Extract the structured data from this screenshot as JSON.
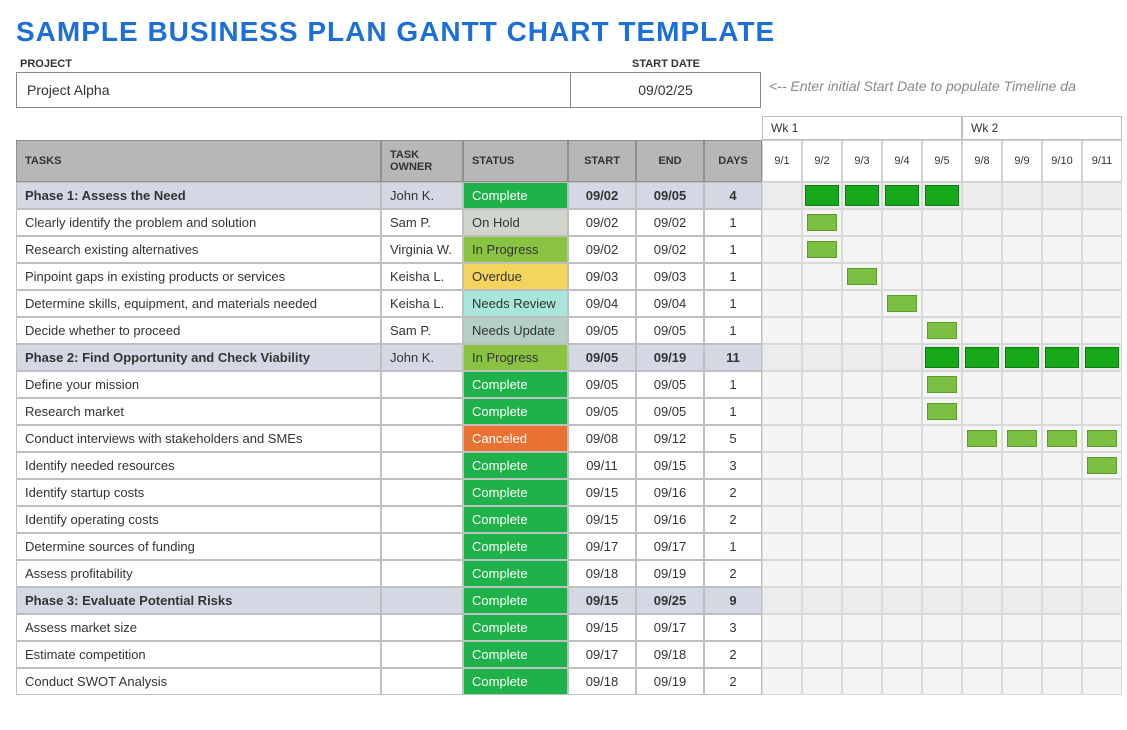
{
  "title": "SAMPLE BUSINESS PLAN GANTT CHART TEMPLATE",
  "labels": {
    "project": "PROJECT",
    "start_date": "START DATE",
    "hint": "<--  Enter initial Start Date to populate Timeline da",
    "tasks": "TASKS",
    "owner": "TASK OWNER",
    "status": "STATUS",
    "start": "START",
    "end": "END",
    "days": "DAYS"
  },
  "project_name": "Project Alpha",
  "project_start": "09/02/25",
  "weeks": [
    "Wk 1",
    "Wk 2"
  ],
  "timeline_days": [
    "9/1",
    "9/2",
    "9/3",
    "9/4",
    "9/5",
    "9/8",
    "9/9",
    "9/10",
    "9/11"
  ],
  "chart_data": {
    "type": "gantt",
    "x_categories": [
      "9/1",
      "9/2",
      "9/3",
      "9/4",
      "9/5",
      "9/8",
      "9/9",
      "9/10",
      "9/11"
    ],
    "rows": [
      {
        "type": "phase",
        "name": "Phase 1: Assess the Need",
        "owner": "John K.",
        "status": "Complete",
        "start": "09/02",
        "end": "09/05",
        "days": 4,
        "bar": [
          1,
          4
        ]
      },
      {
        "type": "task",
        "name": "Clearly identify the problem and solution",
        "owner": "Sam P.",
        "status": "On Hold",
        "start": "09/02",
        "end": "09/02",
        "days": 1,
        "bar": [
          1,
          1
        ]
      },
      {
        "type": "task",
        "name": "Research existing alternatives",
        "owner": "Virginia W.",
        "status": "In Progress",
        "start": "09/02",
        "end": "09/02",
        "days": 1,
        "bar": [
          1,
          1
        ]
      },
      {
        "type": "task",
        "name": "Pinpoint gaps in existing products or services",
        "owner": "Keisha L.",
        "status": "Overdue",
        "start": "09/03",
        "end": "09/03",
        "days": 1,
        "bar": [
          2,
          2
        ]
      },
      {
        "type": "task",
        "name": "Determine skills, equipment, and materials needed",
        "owner": "Keisha L.",
        "status": "Needs Review",
        "start": "09/04",
        "end": "09/04",
        "days": 1,
        "bar": [
          3,
          3
        ]
      },
      {
        "type": "task",
        "name": "Decide whether to proceed",
        "owner": "Sam P.",
        "status": "Needs Update",
        "start": "09/05",
        "end": "09/05",
        "days": 1,
        "bar": [
          4,
          4
        ]
      },
      {
        "type": "phase",
        "name": "Phase 2: Find Opportunity and Check Viability",
        "owner": "John K.",
        "status": "In Progress",
        "start": "09/05",
        "end": "09/19",
        "days": 11,
        "bar": [
          4,
          8
        ]
      },
      {
        "type": "task",
        "name": "Define your mission",
        "owner": "",
        "status": "Complete",
        "start": "09/05",
        "end": "09/05",
        "days": 1,
        "bar": [
          4,
          4
        ]
      },
      {
        "type": "task",
        "name": "Research market",
        "owner": "",
        "status": "Complete",
        "start": "09/05",
        "end": "09/05",
        "days": 1,
        "bar": [
          4,
          4
        ]
      },
      {
        "type": "task",
        "name": "Conduct interviews with stakeholders and SMEs",
        "owner": "",
        "status": "Canceled",
        "start": "09/08",
        "end": "09/12",
        "days": 5,
        "bar": [
          5,
          8
        ]
      },
      {
        "type": "task",
        "name": "Identify needed resources",
        "owner": "",
        "status": "Complete",
        "start": "09/11",
        "end": "09/15",
        "days": 3,
        "bar": [
          8,
          8
        ]
      },
      {
        "type": "task",
        "name": "Identify startup costs",
        "owner": "",
        "status": "Complete",
        "start": "09/15",
        "end": "09/16",
        "days": 2,
        "bar": null
      },
      {
        "type": "task",
        "name": "Identify operating costs",
        "owner": "",
        "status": "Complete",
        "start": "09/15",
        "end": "09/16",
        "days": 2,
        "bar": null
      },
      {
        "type": "task",
        "name": "Determine sources of funding",
        "owner": "",
        "status": "Complete",
        "start": "09/17",
        "end": "09/17",
        "days": 1,
        "bar": null
      },
      {
        "type": "task",
        "name": "Assess profitability",
        "owner": "",
        "status": "Complete",
        "start": "09/18",
        "end": "09/19",
        "days": 2,
        "bar": null
      },
      {
        "type": "phase",
        "name": "Phase 3: Evaluate Potential Risks",
        "owner": "",
        "status": "Complete",
        "start": "09/15",
        "end": "09/25",
        "days": 9,
        "bar": null
      },
      {
        "type": "task",
        "name": "Assess market size",
        "owner": "",
        "status": "Complete",
        "start": "09/15",
        "end": "09/17",
        "days": 3,
        "bar": null
      },
      {
        "type": "task",
        "name": "Estimate competition",
        "owner": "",
        "status": "Complete",
        "start": "09/17",
        "end": "09/18",
        "days": 2,
        "bar": null
      },
      {
        "type": "task",
        "name": "Conduct SWOT Analysis",
        "owner": "",
        "status": "Complete",
        "start": "09/18",
        "end": "09/19",
        "days": 2,
        "bar": null
      }
    ]
  }
}
